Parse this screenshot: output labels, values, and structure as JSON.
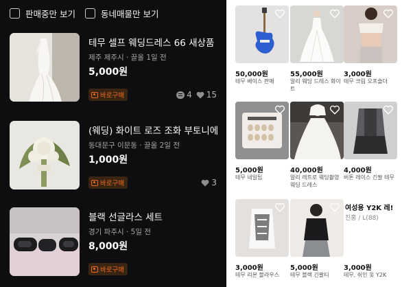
{
  "filters": [
    {
      "label": "판매중만 보기"
    },
    {
      "label": "동네매물만 보기"
    }
  ],
  "listings": [
    {
      "title": "테무 셀프 웨딩드레스 66 새상품",
      "location": "제주 제주시",
      "time": "끌올 1일 전",
      "price": "5,000원",
      "badge": "바로구매",
      "chats": "4",
      "likes": "15"
    },
    {
      "title": "(웨딩) 화이트 로즈 조화 부토니에",
      "location": "동대문구 이문동",
      "time": "끌올 2일 전",
      "price": "1,000원",
      "badge": "바로구매",
      "chats": "",
      "likes": "3"
    },
    {
      "title": "블랙 선글라스 세트",
      "location": "경기 파주시",
      "time": "5일 전",
      "price": "8,000원",
      "badge": "바로구매",
      "chats": "",
      "likes": ""
    }
  ],
  "grid": [
    {
      "price": "50,000원",
      "name": "테무 베이스 판매",
      "image": "bass-guitar"
    },
    {
      "price": "55,000원",
      "name": "알리 웨딩 드레스 화이트",
      "image": "wedding-dress"
    },
    {
      "price": "3,000원",
      "name": "테무 크림 오프숄더",
      "image": "off-shoulder-top"
    },
    {
      "price": "5,000원",
      "name": "테무 네일팁",
      "image": "nail-tips"
    },
    {
      "price": "40,000원",
      "name": "알리 레트로 웨딩촬영 웨딩 드레스",
      "image": "retro-wedding-dress"
    },
    {
      "price": "4,000원",
      "name": "버튼 레이스 긴팔 테무",
      "image": "lace-top"
    },
    {
      "price": "3,000원",
      "name": "테무 리본 블라우스",
      "image": "ribbon-blouse"
    },
    {
      "price": "5,000원",
      "name": "테무 블랙 긴팔티",
      "image": "black-long-sleeve"
    },
    {
      "price": "3,000원",
      "name": "테무, 쉬인 옷 Y2K",
      "image": "y2k-text-card",
      "overlay": {
        "title": "여성용 Y2K 레!",
        "sub": "진홍 / L(88)"
      }
    }
  ],
  "colors": {
    "dark_bg": "#0e0e10",
    "badge_orange": "#f26b1d",
    "white": "#ffffff"
  }
}
